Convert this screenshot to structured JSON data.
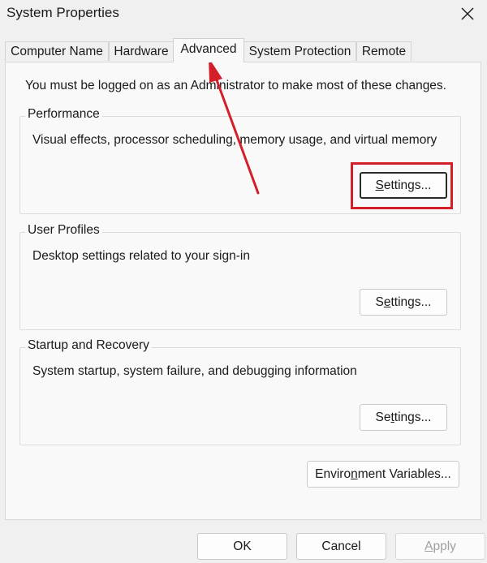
{
  "window": {
    "title": "System Properties"
  },
  "tabs": [
    {
      "label": "Computer Name"
    },
    {
      "label": "Hardware"
    },
    {
      "label": "Advanced",
      "active": true
    },
    {
      "label": "System Protection"
    },
    {
      "label": "Remote"
    }
  ],
  "advanced": {
    "notice": "You must be logged on as an Administrator to make most of these changes.",
    "performance": {
      "title": "Performance",
      "description": "Visual effects, processor scheduling, memory usage, and virtual memory",
      "settings_pre": "",
      "settings_mnemonic": "S",
      "settings_post": "ettings..."
    },
    "user_profiles": {
      "title": "User Profiles",
      "description": "Desktop settings related to your sign-in",
      "settings_pre": "S",
      "settings_mnemonic": "e",
      "settings_post": "ttings..."
    },
    "startup_recovery": {
      "title": "Startup and Recovery",
      "description": "System startup, system failure, and debugging information",
      "settings_pre": "Se",
      "settings_mnemonic": "t",
      "settings_post": "tings..."
    },
    "env_vars": {
      "pre": "Enviro",
      "mnemonic": "n",
      "post": "ment Variables..."
    }
  },
  "footer": {
    "ok": "OK",
    "cancel": "Cancel",
    "apply_mnemonic": "A",
    "apply_post": "pply"
  },
  "colors": {
    "annotation": "#d21f2a",
    "window_bg": "#f0f0f0",
    "pane_bg": "#f9f9f9"
  },
  "icons": {
    "close": "close-icon",
    "annotation_arrow": "arrow-icon"
  }
}
